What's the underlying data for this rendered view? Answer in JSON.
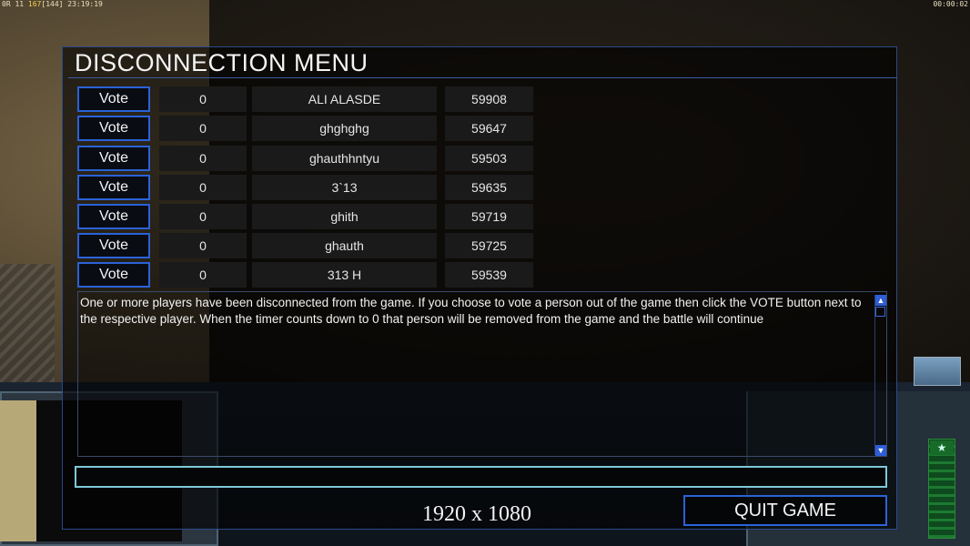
{
  "overlay": {
    "top_left_prefix": "0R 11",
    "top_left_highlight": "167",
    "top_left_dim": "[144]",
    "top_left_clock": "23:19:19",
    "top_right_timer": "00:00:02"
  },
  "menu": {
    "title": "DISCONNECTION MENU",
    "vote_label": "Vote",
    "players": [
      {
        "votes": "0",
        "name": "ALI ALASDE",
        "timer": "59908"
      },
      {
        "votes": "0",
        "name": "ghghghg",
        "timer": "59647"
      },
      {
        "votes": "0",
        "name": "ghauthhntyu",
        "timer": "59503"
      },
      {
        "votes": "0",
        "name": "3`13",
        "timer": "59635"
      },
      {
        "votes": "0",
        "name": "ghith",
        "timer": "59719"
      },
      {
        "votes": "0",
        "name": "ghauth",
        "timer": "59725"
      },
      {
        "votes": "0",
        "name": "313 H",
        "timer": "59539"
      }
    ],
    "message": "One or more players have been disconnected from the game. If you choose to vote a person out of the game then click the VOTE button next to the respective player. When the timer counts down to 0 that person will be removed from the game and the battle will continue",
    "chat_value": "",
    "quit_label": "QUIT GAME"
  },
  "resolution_label": "1920 x 1080",
  "colors": {
    "accent": "#2a62d8",
    "chat_border": "#7ec8d8"
  }
}
